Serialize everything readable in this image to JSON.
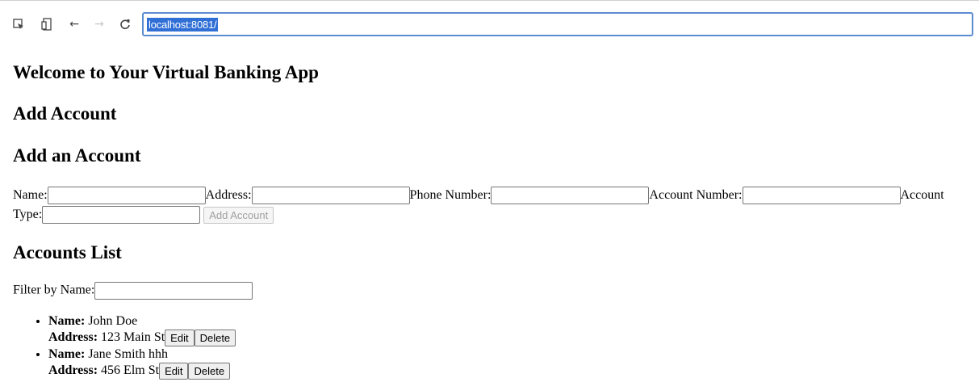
{
  "browser": {
    "url": "localhost:8081/",
    "icons": [
      "inspect-icon",
      "device-toggle-icon",
      "back-arrow-icon",
      "forward-arrow-icon",
      "reload-icon"
    ]
  },
  "page": {
    "main_heading": "Welcome to Your Virtual Banking App",
    "section_heading": "Add Account",
    "form_heading": "Add an Account",
    "form": {
      "name_label": "Name:",
      "address_label": "Address:",
      "phone_label": "Phone Number:",
      "account_number_label": "Account Number:",
      "account_type_label": "Account Type:",
      "name_value": "",
      "address_value": "",
      "phone_value": "",
      "account_number_value": "",
      "account_type_value": "",
      "submit_label": "Add Account"
    },
    "list_heading": "Accounts List",
    "filter": {
      "label": "Filter by Name:",
      "value": ""
    },
    "accounts": [
      {
        "name_label": "Name:",
        "name": "John Doe",
        "address_label": "Address:",
        "address": "123 Main St",
        "edit_label": "Edit",
        "delete_label": "Delete"
      },
      {
        "name_label": "Name:",
        "name": "Jane Smith hhh",
        "address_label": "Address:",
        "address": "456 Elm St",
        "edit_label": "Edit",
        "delete_label": "Delete"
      }
    ]
  }
}
